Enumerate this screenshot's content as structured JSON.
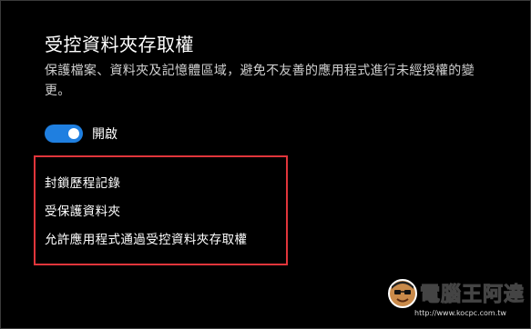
{
  "section": {
    "title": "受控資料夾存取權",
    "description": "保護檔案、資料夾及記憶體區域，避免不友善的應用程式進行未經授權的變更。",
    "toggle": {
      "state": "on",
      "label": "開啟",
      "accent_color": "#1f7fe0"
    }
  },
  "links": [
    {
      "label": "封鎖歷程記錄"
    },
    {
      "label": "受保護資料夾"
    },
    {
      "label": "允許應用程式通過受控資料夾存取權"
    }
  ],
  "highlight_box_color": "#e0353b",
  "watermark": {
    "text": "電腦王阿達",
    "url": "http://www.kocpc.com.tw"
  }
}
